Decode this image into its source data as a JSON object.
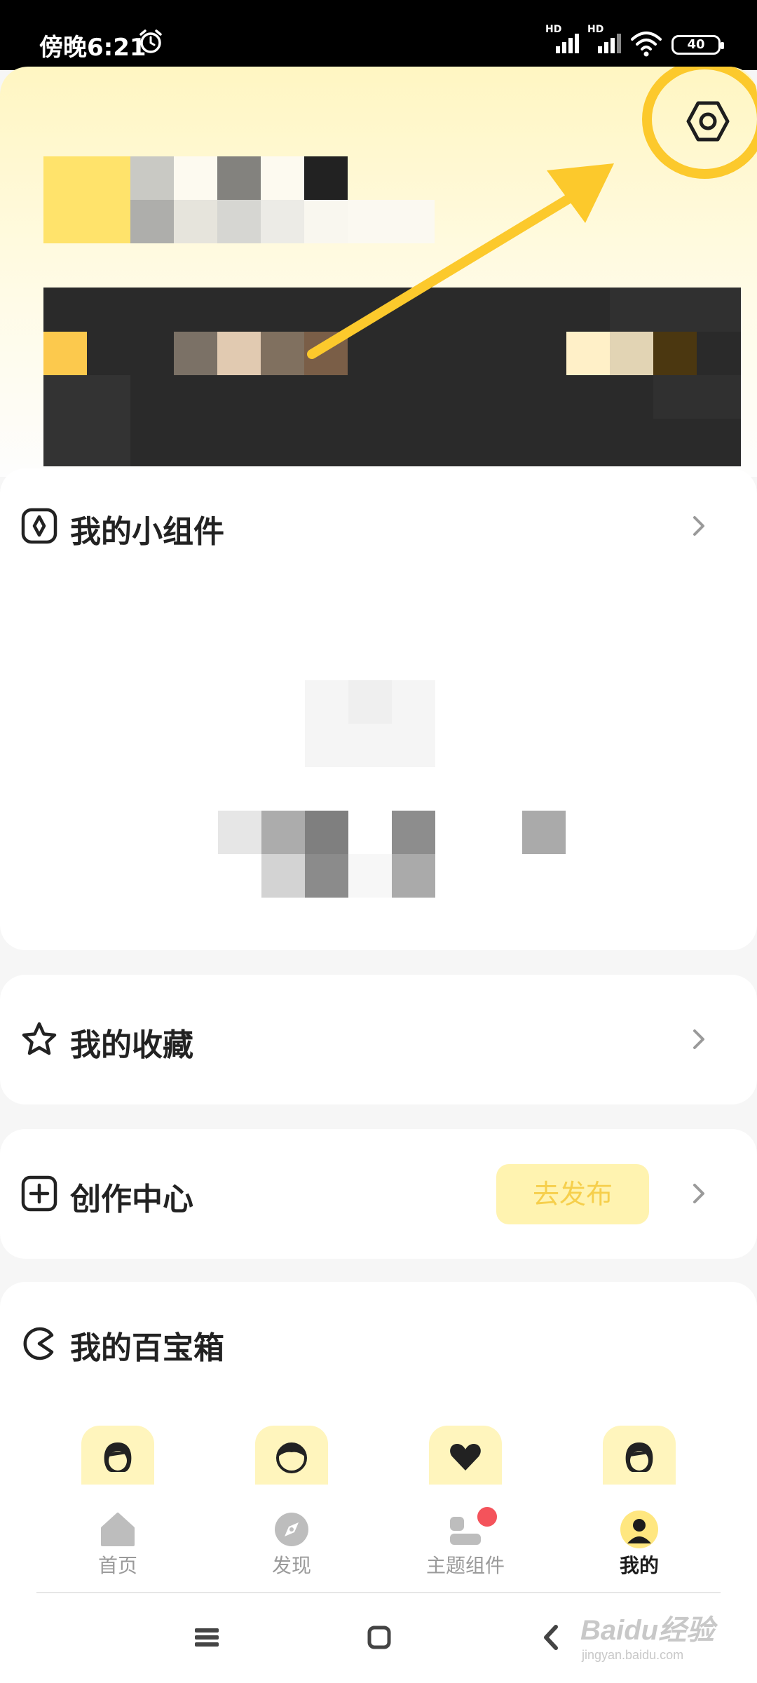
{
  "status_bar": {
    "time": "傍晚6:21",
    "network_label": "HD",
    "battery": "40"
  },
  "sections": {
    "widgets": {
      "title": "我的小组件"
    },
    "favorites": {
      "title": "我的收藏"
    },
    "creator": {
      "title": "创作中心",
      "publish_label": "去发布"
    },
    "toolbox": {
      "title": "我的百宝箱"
    }
  },
  "tabs": [
    {
      "label": "首页",
      "icon": "home-icon"
    },
    {
      "label": "发现",
      "icon": "discover-icon"
    },
    {
      "label": "主题组件",
      "icon": "theme-widgets-icon"
    },
    {
      "label": "我的",
      "icon": "profile-icon",
      "active": true
    }
  ],
  "watermark": {
    "brand": "Baidu经验",
    "url": "jingyan.baidu.com"
  },
  "colors": {
    "accent": "#fcc92c",
    "publish_bg": "#fff3b0",
    "badge": "#f4535b"
  }
}
